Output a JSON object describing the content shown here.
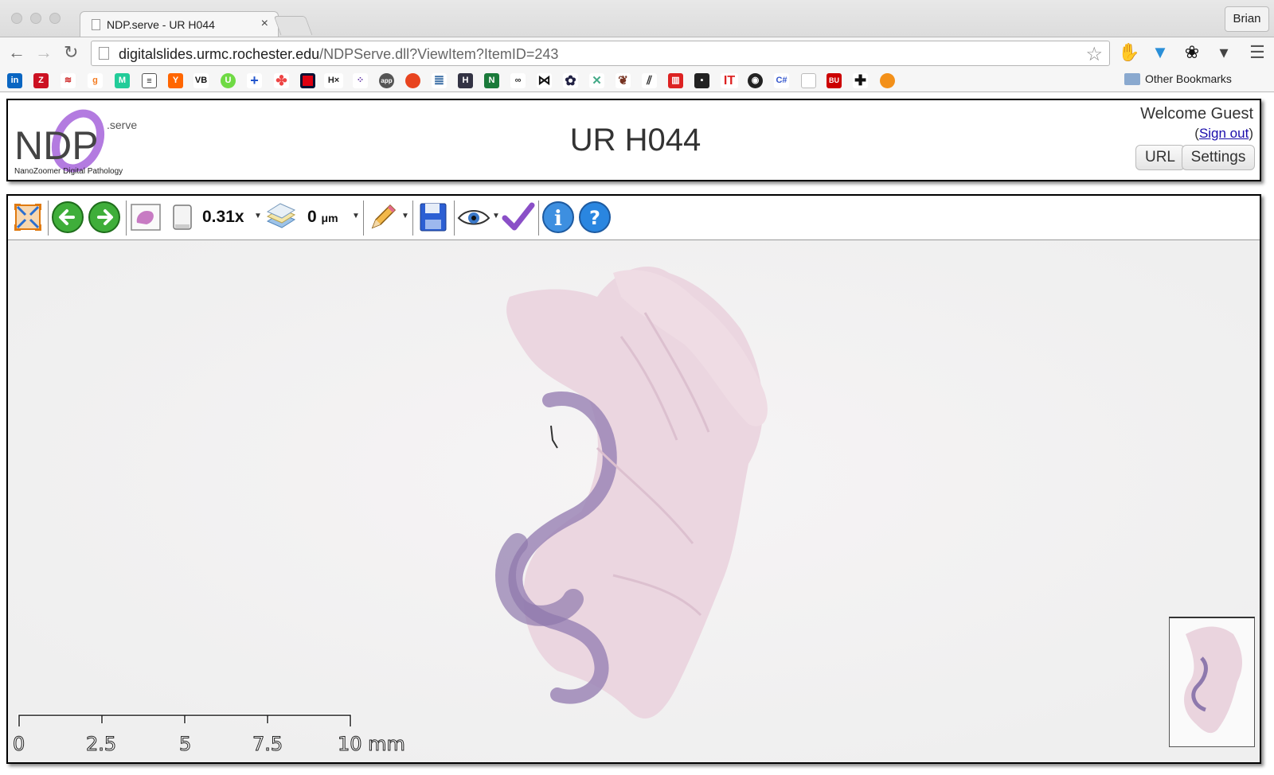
{
  "browser": {
    "tab_title": "NDP.serve - UR H044",
    "tab_close": "×",
    "profile_name": "Brian",
    "url_host": "digitalslides.urmc.rochester.edu",
    "url_path": "/NDPServe.dll?ViewItem?ItemID=243",
    "bookmarks_other": "Other Bookmarks",
    "bookmark_icons": [
      "linkedin-icon",
      "zotero-icon",
      "bank-icon",
      "goodreads-icon",
      "mendeley-icon",
      "news-icon",
      "ycombinator-icon",
      "venturebeat-icon",
      "upwork-icon",
      "plus-icon",
      "pinwheel-icon",
      "grid-icon",
      "hx-icon",
      "dots-icon",
      "app-icon",
      "tomato-icon",
      "database-icon",
      "hub-icon",
      "chart-icon",
      "link-icon",
      "bow-icon",
      "gear-icon",
      "molecule-icon",
      "feather-icon",
      "lines-icon",
      "bars-icon",
      "film-icon",
      "it-icon",
      "ubuntu-icon",
      "csharp-icon",
      "page-icon",
      "bu-icon",
      "cross-icon",
      "hexagon-icon"
    ]
  },
  "header": {
    "logo_text": "NDP",
    "logo_suffix": ".serve",
    "logo_tagline": "NanoZoomer Digital Pathology",
    "title": "UR H044",
    "welcome": "Welcome Guest",
    "signout_label": "Sign out",
    "url_button": "URL",
    "settings_button": "Settings"
  },
  "toolbar": {
    "magnification": "0.31x",
    "focus_value": "0",
    "focus_unit": "μm"
  },
  "scalebar": {
    "labels": [
      "0",
      "2.5",
      "5",
      "7.5",
      "10 mm"
    ]
  }
}
